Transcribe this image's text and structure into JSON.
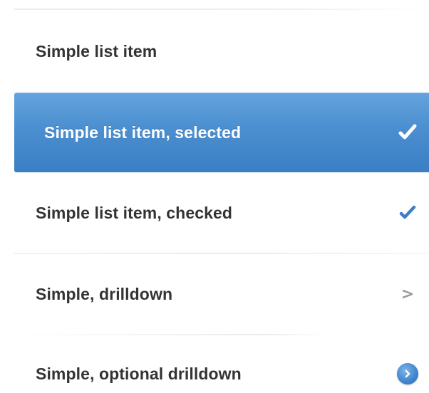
{
  "list": {
    "items": [
      {
        "label": "Simple list item",
        "accessory": "none"
      },
      {
        "label": "Simple list item, selected",
        "accessory": "checkmark-icon",
        "selected": true
      },
      {
        "label": "Simple list item, checked",
        "accessory": "checkmark-icon",
        "checked": true
      },
      {
        "label": "Simple, drilldown",
        "accessory": "chevron-right-icon"
      },
      {
        "label": "Simple, optional drilldown",
        "accessory": "detail-disclosure-icon"
      }
    ],
    "chevron_glyph": ">"
  },
  "colors": {
    "selected_background": "#4b8fd0",
    "selected_text": "#ffffff",
    "label_text": "#333333",
    "checkmark_accent": "#3f7ec6",
    "chevron": "#9a9a9a",
    "divider": "#eceef0"
  }
}
